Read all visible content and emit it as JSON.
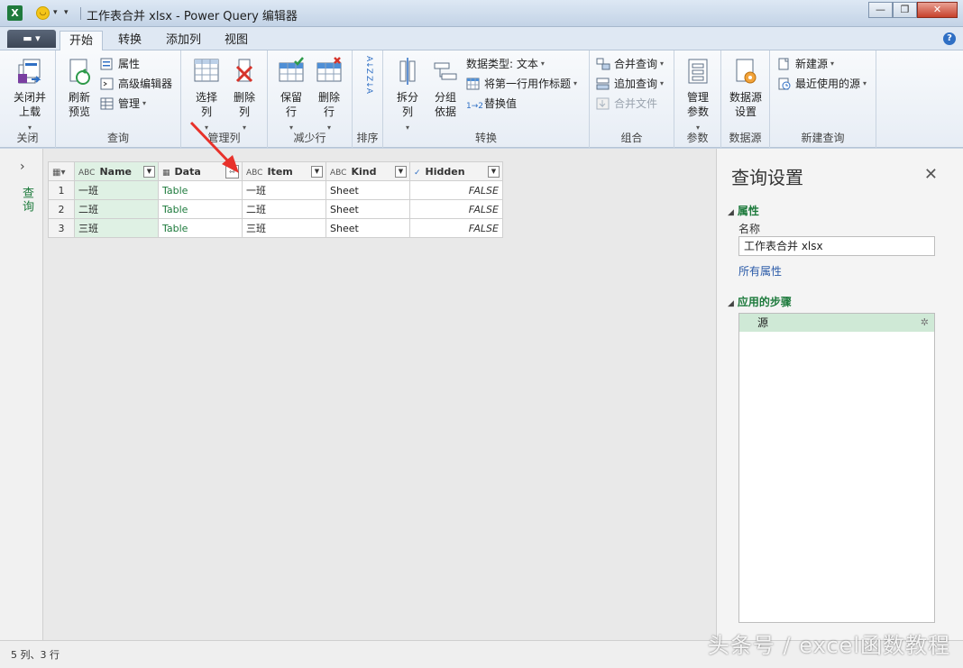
{
  "window": {
    "title": "工作表合并 xlsx - Power Query 编辑器",
    "app_icon_label": "X",
    "controls": {
      "minimize": "—",
      "restore": "❐",
      "close": "✕"
    }
  },
  "tabs": {
    "file_label": "▬ ▾",
    "items": [
      "开始",
      "转换",
      "添加列",
      "视图"
    ],
    "active": "开始",
    "help": "?"
  },
  "ribbon": {
    "close": {
      "label": "关闭",
      "close_load": "关闭并\n上载"
    },
    "query": {
      "label": "查询",
      "refresh": "刷新\n预览",
      "properties": "属性",
      "advanced_editor": "高级编辑器",
      "manage": "管理"
    },
    "manage_columns": {
      "label": "管理列",
      "choose_columns": "选择\n列",
      "remove_columns": "删除\n列"
    },
    "reduce_rows": {
      "label": "减少行",
      "keep_rows": "保留\n行",
      "remove_rows": "删除\n行"
    },
    "sort": {
      "label": "排序",
      "asc": "A↓Z",
      "desc": "Z↓A"
    },
    "transform": {
      "label": "转换",
      "split_column": "拆分\n列",
      "group_by": "分组\n依据",
      "data_type": "数据类型: 文本",
      "use_first_row": "将第一行用作标题",
      "replace_values": "替换值"
    },
    "combine": {
      "label": "组合",
      "merge_queries": "合并查询",
      "append_queries": "追加查询",
      "combine_files": "合并文件"
    },
    "parameters": {
      "label": "参数",
      "manage_parameters": "管理\n参数"
    },
    "data_source": {
      "label": "数据源",
      "data_source_settings": "数据源\n设置"
    },
    "new_query": {
      "label": "新建查询",
      "new_source": "新建源",
      "recent_sources": "最近使用的源"
    }
  },
  "nav": {
    "collapse_icon": "›",
    "queries_label": "查询"
  },
  "grid": {
    "columns": [
      {
        "name": "Name",
        "type_icon": "ABC",
        "control": "filter"
      },
      {
        "name": "Data",
        "type_icon": "table-icon",
        "control": "expand"
      },
      {
        "name": "Item",
        "type_icon": "ABC",
        "control": "filter"
      },
      {
        "name": "Kind",
        "type_icon": "ABC",
        "control": "filter"
      },
      {
        "name": "Hidden",
        "type_icon": "check-icon",
        "control": "filter"
      }
    ],
    "rows": [
      {
        "n": "1",
        "name": "一班",
        "data": "Table",
        "item": "一班",
        "kind": "Sheet",
        "hidden": "FALSE"
      },
      {
        "n": "2",
        "name": "二班",
        "data": "Table",
        "item": "二班",
        "kind": "Sheet",
        "hidden": "FALSE"
      },
      {
        "n": "3",
        "name": "三班",
        "data": "Table",
        "item": "三班",
        "kind": "Sheet",
        "hidden": "FALSE"
      }
    ]
  },
  "settings": {
    "title": "查询设置",
    "properties_header": "属性",
    "name_label": "名称",
    "name_value": "工作表合并 xlsx",
    "all_properties": "所有属性",
    "steps_header": "应用的步骤",
    "steps": [
      "源"
    ]
  },
  "status": {
    "text": "5 列、3 行"
  },
  "watermark": "头条号 / excel函数教程",
  "colors": {
    "accent_green": "#1d7a3c",
    "selected_cell": "#dff1e4",
    "arrow_red": "#e8312a"
  }
}
